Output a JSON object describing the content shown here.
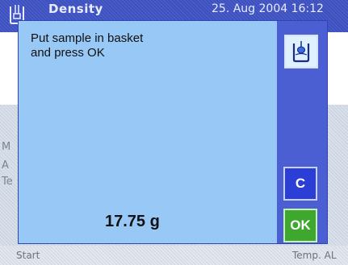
{
  "app": {
    "title": "Density",
    "datetime": "25. Aug 2004   16:12"
  },
  "background": {
    "partial_labels": [
      "M",
      "A",
      "Te"
    ],
    "softkeys": {
      "left": "Start",
      "right": "Temp. AL"
    }
  },
  "dialog": {
    "message": "Put sample in basket\nand press OK",
    "weight": "17.75 g",
    "buttons": {
      "cancel": "C",
      "ok": "OK"
    }
  },
  "icons": {
    "app": "density-beaker-icon",
    "basket": "basket-in-beaker-icon"
  },
  "colors": {
    "titlebar": "#3c50c0",
    "dialog_bg": "#98c8f6",
    "dialog_side": "#4b5fd2",
    "ok_button": "#3ea82e",
    "cancel_button": "#2b3fd6"
  }
}
